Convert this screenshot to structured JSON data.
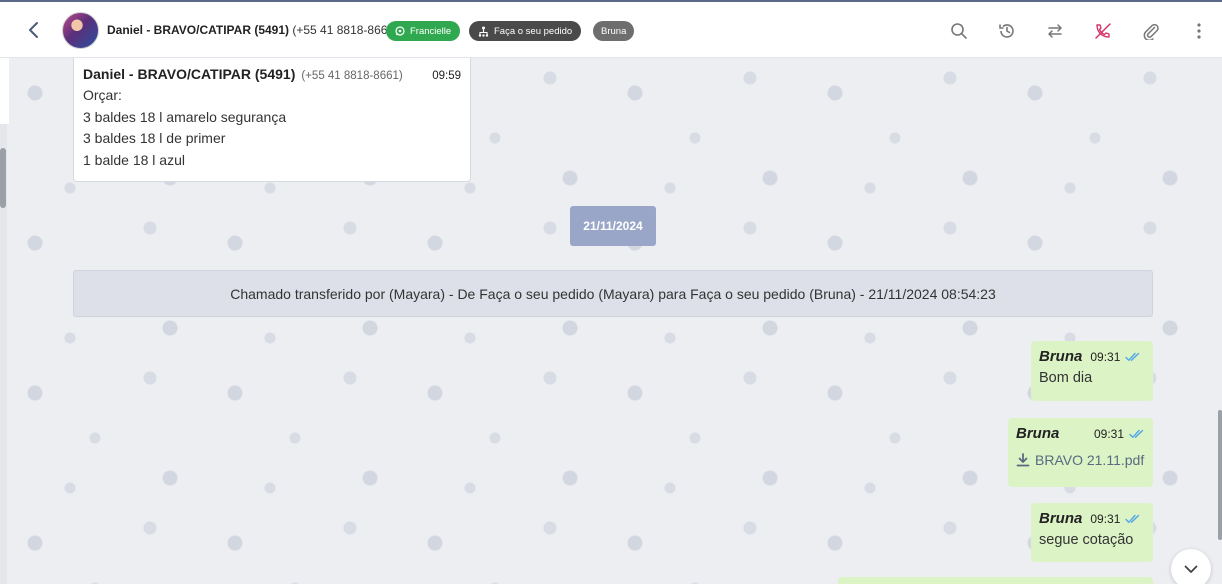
{
  "header": {
    "contact_name": "Daniel - BRAVO/CATIPAR (5491)",
    "contact_phone": " (+55 41 8818-8661)",
    "tags": {
      "whatsapp": "Francielle",
      "queue": "Faça o seu pedido",
      "agent": "Bruna"
    },
    "icons": [
      "search-icon",
      "history-icon",
      "transfer-icon",
      "end-call-icon",
      "attach-icon",
      "more-vertical-icon"
    ]
  },
  "quoted_message": {
    "sender": "Daniel - BRAVO/CATIPAR (5491)",
    "phone": "(+55 41 8818-8661)",
    "time": "09:59",
    "lines": [
      "Orçar:",
      "3 baldes 18 l amarelo segurança",
      "3 baldes 18 l de primer",
      "1 balde 18 l azul"
    ]
  },
  "date_separator": "21/11/2024",
  "system_message": "Chamado transferido por (Mayara) - De Faça o seu pedido (Mayara) para Faça o seu pedido (Bruna) - 21/11/2024 08:54:23",
  "messages": [
    {
      "sender": "Bruna",
      "time": "09:31",
      "text": "Bom dia"
    },
    {
      "sender": "Bruna",
      "time": "09:31",
      "file": "BRAVO 21.11.pdf"
    },
    {
      "sender": "Bruna",
      "time": "09:31",
      "text": "segue cotação"
    }
  ],
  "colors": {
    "outgoing_bubble": "#dcf3c6",
    "whatsapp_tag": "#2fa84f",
    "queue_tag": "#4a4a4a",
    "agent_tag": "#6e6e6e",
    "date_badge": "#9aa6c8",
    "end_call_icon": "#d6336c",
    "read_check": "#4fa6e8"
  }
}
